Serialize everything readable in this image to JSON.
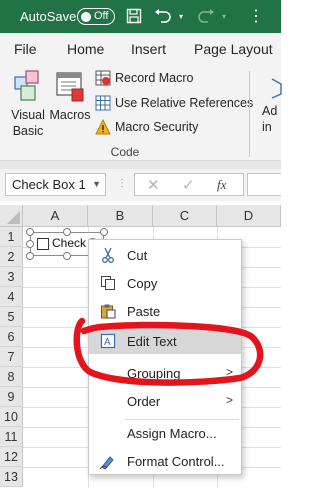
{
  "titlebar": {
    "autosave_label": "AutoSave",
    "toggle_state": "Off"
  },
  "ribbon": {
    "tabs": [
      "File",
      "Home",
      "Insert",
      "Page Layout"
    ],
    "visual_basic": {
      "line1": "Visual",
      "line2": "Basic"
    },
    "macros": "Macros",
    "record_macro": "Record Macro",
    "relative_refs": "Use Relative References",
    "macro_security": "Macro Security",
    "group_label": "Code",
    "addins_partial": {
      "line1": "Ad",
      "line2": "in"
    }
  },
  "formula_bar": {
    "name_box": "Check Box 1",
    "fx": "fx"
  },
  "grid": {
    "columns": [
      "A",
      "B",
      "C",
      "D"
    ],
    "rows": [
      "1",
      "2",
      "3",
      "4",
      "5",
      "6",
      "7",
      "8",
      "9",
      "10",
      "11",
      "12",
      "13"
    ],
    "checkbox_label": "Check B"
  },
  "context_menu": {
    "cut": "Cut",
    "copy": "Copy",
    "paste": "Paste",
    "edit_text": "Edit Text",
    "grouping": "Grouping",
    "order": "Order",
    "assign_macro": "Assign Macro...",
    "format_control": "Format Control..."
  },
  "colors": {
    "excel_green": "#217346",
    "annotation_red": "#e4141d",
    "highlight": "#d7d7d7"
  }
}
